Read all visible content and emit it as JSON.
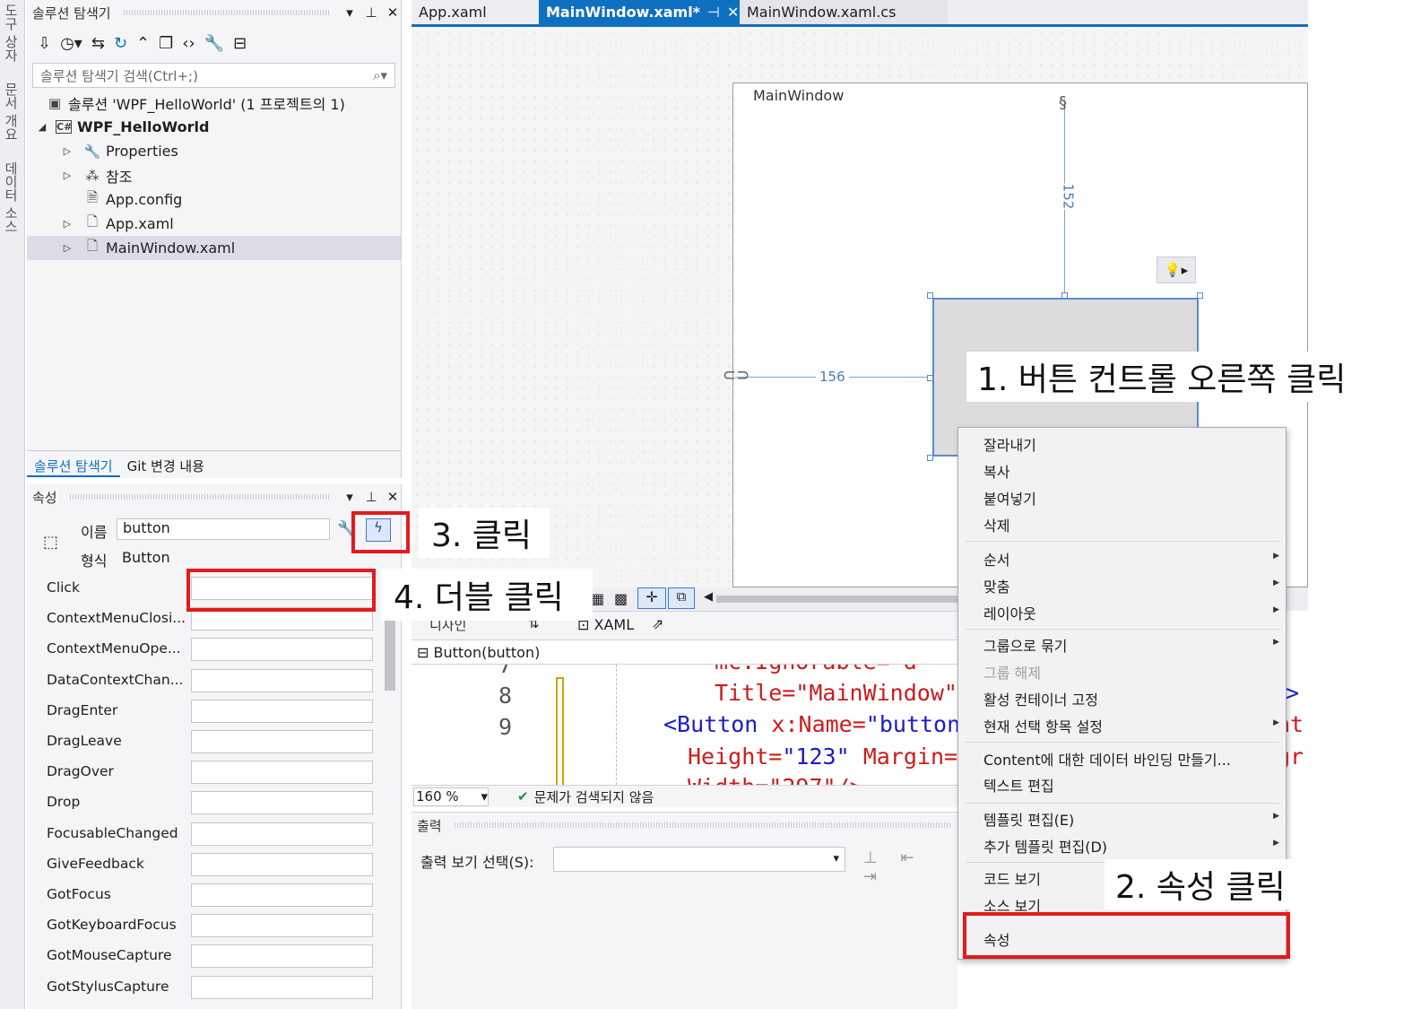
{
  "vertical_tabs": [
    "도구 상자",
    "문서 개요",
    "데이터 소스"
  ],
  "solution_explorer": {
    "title": "솔루션 탐색기",
    "search_placeholder": "솔루션 탐색기 검색(Ctrl+;)",
    "tree": [
      {
        "label": "솔루션 'WPF_HelloWorld' (1 프로젝트의 1)",
        "icon": "solution-icon"
      },
      {
        "label": "WPF_HelloWorld",
        "icon": "csharp-project-icon"
      },
      {
        "label": "Properties",
        "icon": "wrench-icon"
      },
      {
        "label": "참조",
        "icon": "references-icon"
      },
      {
        "label": "App.config",
        "icon": "config-file-icon"
      },
      {
        "label": "App.xaml",
        "icon": "xaml-file-icon"
      },
      {
        "label": "MainWindow.xaml",
        "icon": "xaml-file-icon"
      }
    ],
    "bottom_tabs": [
      "솔루션 탐색기",
      "Git 변경 내용"
    ]
  },
  "properties": {
    "title": "속성",
    "name_label": "이름",
    "name_value": "button",
    "type_label": "형식",
    "type_value": "Button",
    "events": [
      "Click",
      "ContextMenuClosi...",
      "ContextMenuOpe...",
      "DataContextChan...",
      "DragEnter",
      "DragLeave",
      "DragOver",
      "Drop",
      "FocusableChanged",
      "GiveFeedback",
      "GotFocus",
      "GotKeyboardFocus",
      "GotMouseCapture",
      "GotStylusCapture"
    ]
  },
  "doc_tabs": [
    "App.xaml",
    "MainWindow.xaml*",
    "MainWindow.xaml.cs"
  ],
  "designer": {
    "window_title": "MainWindow",
    "margin_top": "152",
    "margin_left": "156"
  },
  "split_bar": {
    "design_tab": "디자인",
    "xaml_tab": "XAML"
  },
  "breadcrumb": "Button(button)",
  "code": {
    "line_numbers": [
      "7",
      "8",
      "9"
    ],
    "line7": "mc:Ignorable=\"d\"",
    "line8_text": "Title=\"MainWindow\"",
    "line8_end": ">",
    "line9_tag": "<Button",
    "line9_attr": "x:Name=",
    "line9_val": "\"button",
    "line9_tail": "nt",
    "line10_attr1": "Height=",
    "line10_val1": "\"123\"",
    "line10_attr2": "Margin=",
    "line10_tail": "gr",
    "line11": "Width=\"297\"/>"
  },
  "status": {
    "zoom": "160 %",
    "issues": "문제가 검색되지 않음"
  },
  "output": {
    "title": "출력",
    "select_label": "출력 보기 선택(S):"
  },
  "context_menu": {
    "items": [
      {
        "label": "잘라내기"
      },
      {
        "label": "복사"
      },
      {
        "label": "붙여넣기"
      },
      {
        "label": "삭제"
      },
      {
        "label": "순서",
        "sub": true
      },
      {
        "label": "맞춤",
        "sub": true
      },
      {
        "label": "레이아웃",
        "sub": true
      },
      {
        "label": "그룹으로 묶기",
        "sub": true
      },
      {
        "label": "그룹 해제",
        "disabled": true
      },
      {
        "label": "활성 컨테이너 고정"
      },
      {
        "label": "현재 선택 항목 설정",
        "sub": true
      },
      {
        "label": "Content에 대한 데이터 바인딩 만들기..."
      },
      {
        "label": "텍스트 편집"
      },
      {
        "label": "템플릿 편집(E)",
        "sub": true
      },
      {
        "label": "추가 템플릿 편집(D)",
        "sub": true
      },
      {
        "label": "코드 보기"
      },
      {
        "label": "소스 보기"
      },
      {
        "label": "속성"
      }
    ]
  },
  "callouts": {
    "step1": "1. 버튼 컨트롤 오른쪽 클릭",
    "step2": "2. 속성 클릭",
    "step3": "3. 클릭",
    "step4": "4. 더블 클릭"
  },
  "colors": {
    "accent": "#0e70c0",
    "highlight": "#e31b1b"
  }
}
